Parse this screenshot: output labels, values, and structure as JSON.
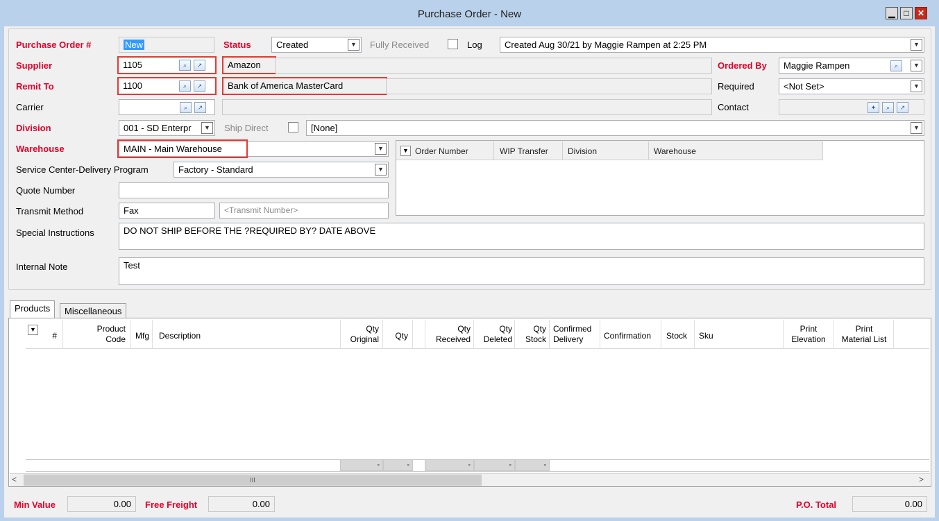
{
  "window": {
    "title": "Purchase Order - New",
    "minimize": "▁",
    "maximize": "□",
    "close": "✕"
  },
  "header": {
    "po_label": "Purchase Order #",
    "po_value": "New",
    "status_label": "Status",
    "status_value": "Created",
    "fully_received_label": "Fully Received",
    "log_label": "Log",
    "log_value": "Created Aug 30/21 by Maggie Rampen at 2:25 PM",
    "supplier_label": "Supplier",
    "supplier_code": "1105",
    "supplier_name": "Amazon",
    "remit_label": "Remit To",
    "remit_code": "1100",
    "remit_name": "Bank of America MasterCard",
    "carrier_label": "Carrier",
    "carrier_code": "",
    "carrier_name": "",
    "division_label": "Division",
    "division_value": "001 - SD Enterpr",
    "ship_direct_label": "Ship Direct",
    "ship_direct_value": "[None]",
    "warehouse_label": "Warehouse",
    "warehouse_value": "MAIN - Main Warehouse",
    "service_label": "Service Center-Delivery Program",
    "service_value": "Factory - Standard",
    "quote_label": "Quote Number",
    "quote_value": "",
    "transmit_label": "Transmit Method",
    "transmit_value": "Fax",
    "transmit_placeholder": "<Transmit Number>",
    "special_label": "Special Instructions",
    "special_value": "DO NOT SHIP BEFORE THE ?REQUIRED BY? DATE ABOVE",
    "internal_label": "Internal Note",
    "internal_value": "Test",
    "ordered_by_label": "Ordered By",
    "ordered_by_value": "Maggie Rampen",
    "required_label": "Required",
    "required_value": "<Not Set>",
    "contact_label": "Contact",
    "contact_value": ""
  },
  "linked_orders": {
    "columns": [
      "Order Number",
      "WIP Transfer",
      "Division",
      "Warehouse"
    ]
  },
  "tabs": [
    {
      "label": "Products"
    },
    {
      "label": "Miscellaneous"
    }
  ],
  "products_grid": {
    "columns": [
      {
        "label": "#"
      },
      {
        "label": "Product\nCode"
      },
      {
        "label": "Mfg"
      },
      {
        "label": "Description"
      },
      {
        "label": "Qty\nOriginal"
      },
      {
        "label": "Qty"
      },
      {
        "label": "Qty\nReceived"
      },
      {
        "label": "Qty\nDeleted"
      },
      {
        "label": "Qty\nStock"
      },
      {
        "label": "Confirmed\nDelivery"
      },
      {
        "label": "Confirmation"
      },
      {
        "label": "Stock"
      },
      {
        "label": "Sku"
      },
      {
        "label": "Print\nElevation"
      },
      {
        "label": "Print\nMaterial List"
      }
    ],
    "totals": [
      "-",
      "-",
      "-",
      "-",
      "-"
    ],
    "scroll_grip": "III",
    "scroll_left": "<",
    "scroll_right": ">"
  },
  "footer": {
    "min_value_label": "Min Value",
    "min_value": "0.00",
    "free_freight_label": "Free Freight",
    "free_freight": "0.00",
    "po_total_label": "P.O. Total",
    "po_total": "0.00"
  },
  "icons": {
    "dropdown": "chevron-down-icon",
    "search": "search-icon",
    "link": "link-icon",
    "new": "new-icon"
  }
}
